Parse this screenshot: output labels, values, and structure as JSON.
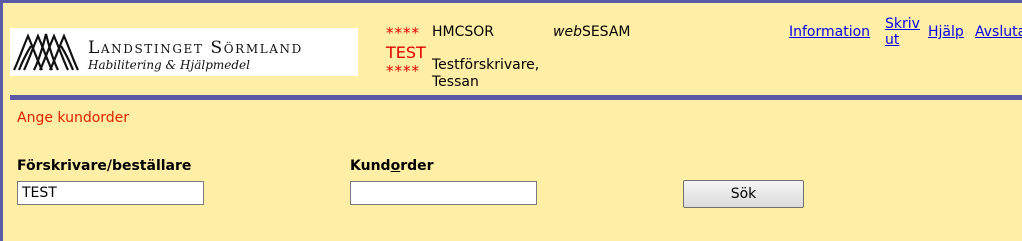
{
  "logo": {
    "name": "Landstinget Sörmland",
    "subtitle": "Habilitering & Hjälpmedel"
  },
  "header": {
    "stars": "****",
    "test_label": "TEST",
    "user_code": "HMCSOR",
    "prescriber_line1": "Testförskrivare,",
    "prescriber_line2": "Tessan",
    "app_name_prefix": "web",
    "app_name_suffix": "SESAM"
  },
  "nav": {
    "information": "Information",
    "skriv_line1": "Skriv",
    "skriv_line2": "ut",
    "hjalp": "Hjälp",
    "avsluta": "Avsluta"
  },
  "page": {
    "title": "Ange kundorder"
  },
  "form": {
    "prescriber_label": "Förskrivare/beställare",
    "prescriber_value": "TEST",
    "order_label_pre": "Kund",
    "order_label_u": "o",
    "order_label_post": "rder",
    "order_value": "",
    "search_button": "Sök"
  },
  "colors": {
    "background": "#ffeea5",
    "border": "#5a5aa8",
    "accent_red": "#e00000",
    "link": "#0000ee"
  }
}
